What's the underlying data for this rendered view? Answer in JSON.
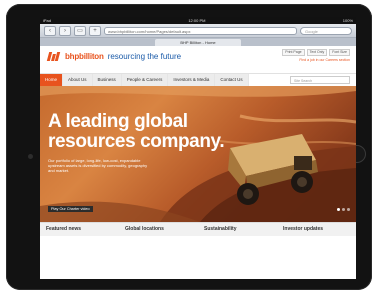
{
  "browser": {
    "status_left": "iPad",
    "status_time": "12:00 PM",
    "status_right": "100%",
    "url": "www.bhpbilliton.com/home/Pages/default.aspx",
    "search_placeholder": "Google",
    "tab_title": "BHP Billiton - Home"
  },
  "site": {
    "logo_text": "bhpbilliton",
    "tagline": "resourcing the future",
    "utility_links": [
      "Print Page",
      "Text Only",
      "Font Size"
    ],
    "utility_note": "Find a job in our Careers section",
    "nav": [
      "Home",
      "About Us",
      "Business",
      "People & Careers",
      "Investors & Media",
      "Contact Us"
    ],
    "nav_search_placeholder": "Site Search",
    "hero": {
      "title_line1": "A leading global",
      "title_line2": "resources company.",
      "body": "Our portfolio of large, long-life, low-cost, expandable upstream assets is diversified by commodity, geography and market.",
      "cta": "Play Our Charter video",
      "slides": 3,
      "active_slide": 1
    },
    "sections": [
      "Featured news",
      "Global locations",
      "Sustainability",
      "Investor updates"
    ]
  },
  "colors": {
    "brand_orange": "#e8531e",
    "brand_blue": "#1a5aa8"
  }
}
